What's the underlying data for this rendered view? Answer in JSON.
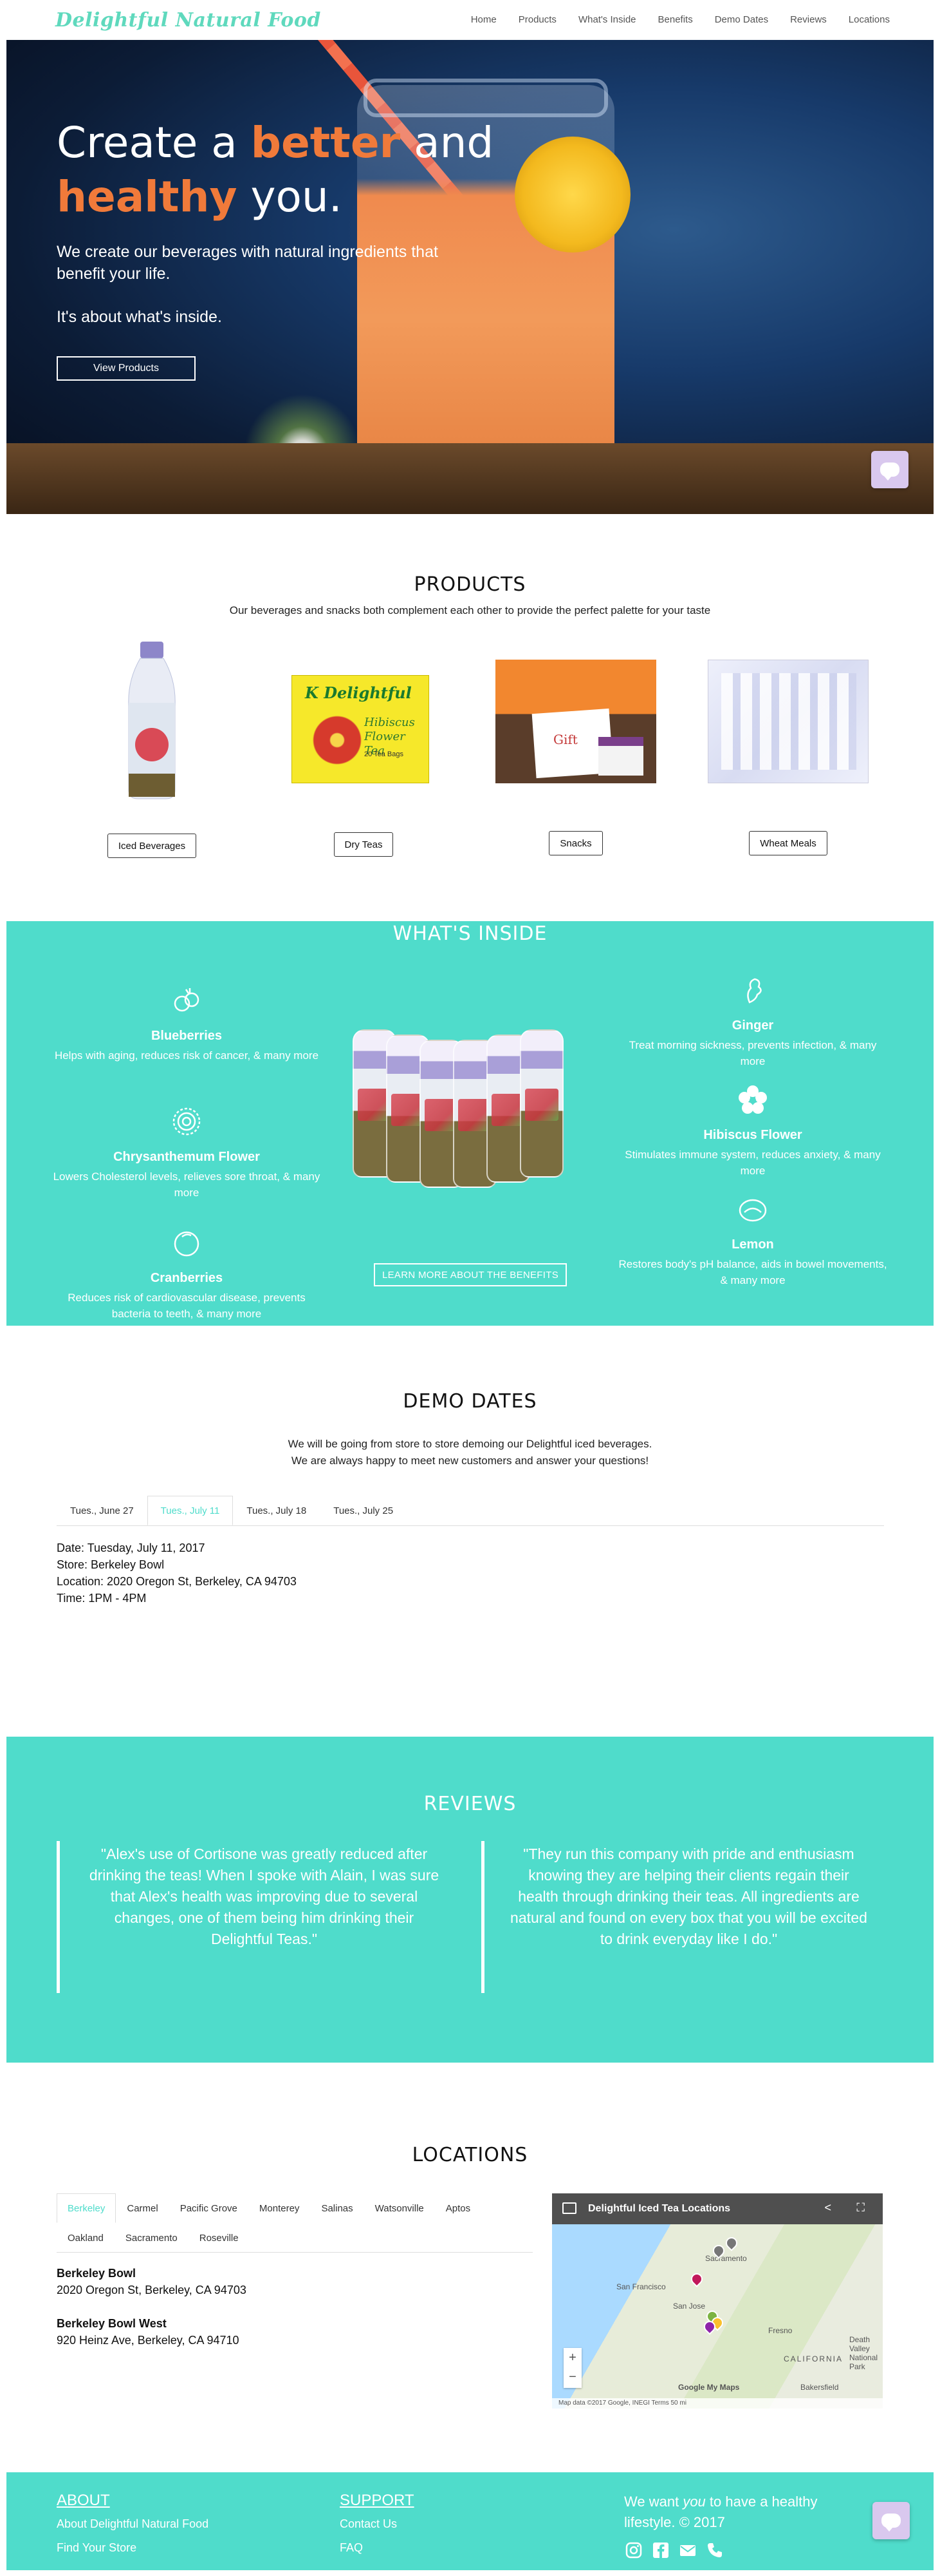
{
  "brand": "Delightful Natural Food",
  "nav": [
    "Home",
    "Products",
    "What's Inside",
    "Benefits",
    "Demo Dates",
    "Reviews",
    "Locations"
  ],
  "hero": {
    "h1_a": "Create a ",
    "h1_accent1": "better",
    "h1_b": " and",
    "h1_accent2": "healthy",
    "h1_c": " you.",
    "sub": "We create our beverages with natural ingredients that benefit your life.",
    "sub2": "It's about what's inside.",
    "button": "View Products"
  },
  "products": {
    "title": "PRODUCTS",
    "subtitle": "Our beverages and snacks both complement each other to provide the perfect palette for your taste",
    "items": [
      {
        "label": "Iced Beverages"
      },
      {
        "label": "Dry Teas",
        "packaging_text": [
          "K Delightful",
          "Hibiscus",
          "Flower Tea",
          "20 Tea Bags"
        ]
      },
      {
        "label": "Snacks",
        "packaging_text": "Gift"
      },
      {
        "label": "Wheat Meals"
      }
    ]
  },
  "whats_inside": {
    "title": "WHAT'S INSIDE",
    "left": [
      {
        "name": "Blueberries",
        "desc": "Helps with aging, reduces risk of cancer, & many more",
        "icon": "blueberries-icon"
      },
      {
        "name": "Chrysanthemum Flower",
        "desc": "Lowers Cholesterol levels, relieves sore throat, & many more",
        "icon": "chrysanthemum-icon"
      },
      {
        "name": "Cranberries",
        "desc": "Reduces risk of cardiovascular disease, prevents bacteria to teeth, & many more",
        "icon": "cranberry-icon"
      }
    ],
    "right": [
      {
        "name": "Ginger",
        "desc": "Treat morning sickness, prevents infection, & many more",
        "icon": "ginger-icon"
      },
      {
        "name": "Hibiscus Flower",
        "desc": "Stimulates immune system, reduces anxiety, & many more",
        "icon": "hibiscus-icon"
      },
      {
        "name": "Lemon",
        "desc": "Restores body's pH balance, aids in bowel movements, & many more",
        "icon": "lemon-icon"
      }
    ],
    "button": "LEARN MORE ABOUT THE BENEFITS"
  },
  "demo": {
    "title": "DEMO DATES",
    "subtitle1": "We will be going from store to store demoing our Delightful iced beverages.",
    "subtitle2": "We are always happy to meet new customers and answer your questions!",
    "tabs": [
      "Tues., June 27",
      "Tues., July 11",
      "Tues., July 18",
      "Tues., July 25"
    ],
    "active_tab": 1,
    "info": {
      "date": "Date: Tuesday, July 11, 2017",
      "store": "Store: Berkeley Bowl",
      "location": "Location: 2020 Oregon St, Berkeley, CA 94703",
      "time": "Time: 1PM - 4PM"
    }
  },
  "reviews": {
    "title": "REVIEWS",
    "quotes": [
      "\"Alex's use of Cortisone was greatly reduced after drinking the teas! When I spoke with Alain, I was sure that Alex's health was improving due to several changes, one of them being him drinking their Delightful Teas.\"",
      "\"They run this company with pride and enthusiasm knowing they are helping their clients regain their health through drinking their teas. All ingredients are natural and found on every box that you will be excited to drink everyday like I do.\""
    ]
  },
  "locations": {
    "title": "LOCATIONS",
    "tabs_row1": [
      "Berkeley",
      "Carmel",
      "Pacific Grove",
      "Monterey",
      "Salinas",
      "Watsonville",
      "Aptos"
    ],
    "tabs_row2": [
      "Oakland",
      "Sacramento",
      "Roseville"
    ],
    "active_tab": "Berkeley",
    "stores": [
      {
        "name": "Berkeley Bowl",
        "address": "2020 Oregon St, Berkeley, CA 94703"
      },
      {
        "name": "Berkeley Bowl West",
        "address": "920 Heinz Ave, Berkeley, CA 94710"
      }
    ],
    "map": {
      "title": "Delightful Iced Tea Locations",
      "labels": [
        "Sacramento",
        "San Francisco",
        "San Jose",
        "Fresno",
        "CALIFORNIA",
        "Bakersfield",
        "Death Valley National Park"
      ],
      "attribution": "Map data ©2017 Google, INEGI   Terms   50 mi",
      "google": "Google My Maps"
    }
  },
  "footer": {
    "about_title": "ABOUT",
    "about_links": [
      "About Delightful Natural Food",
      "Find Your Store"
    ],
    "support_title": "SUPPORT",
    "support_links": [
      "Contact Us",
      "FAQ"
    ],
    "tag_a": "We want ",
    "tag_em": "you",
    "tag_b": " to have a healthy lifestyle. © 2017",
    "icons": [
      "instagram-icon",
      "facebook-icon",
      "email-icon",
      "phone-icon"
    ]
  },
  "colors": {
    "teal": "#4fdccb",
    "accent": "#f07a3a",
    "brand": "#5fd9bd"
  }
}
